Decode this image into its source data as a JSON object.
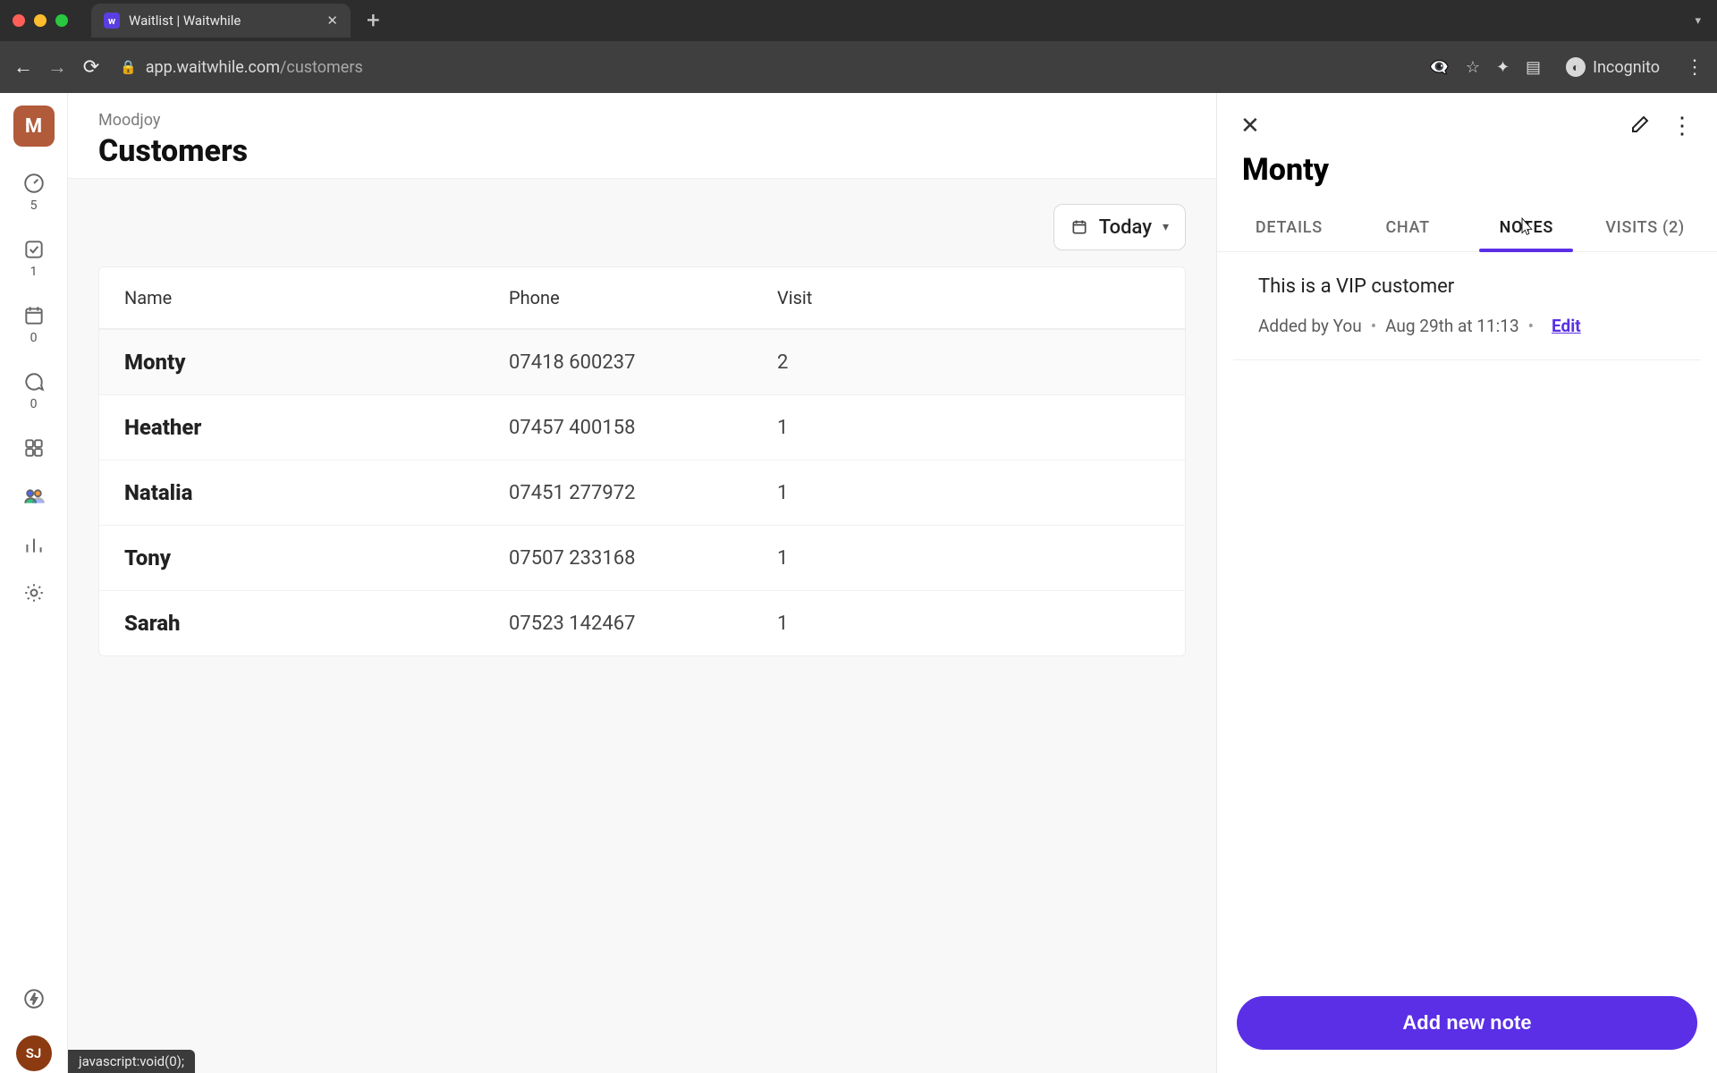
{
  "browser": {
    "tab_title": "Waitlist | Waitwhile",
    "favicon_letter": "w",
    "url_host": "app.waitwhile.com",
    "url_path": "/customers",
    "incognito_label": "Incognito",
    "status_text": "javascript:void(0);"
  },
  "sidebar": {
    "org_initial": "M",
    "user_initials": "SJ",
    "counts": {
      "dashboard": "5",
      "queue": "1",
      "calendar": "0",
      "chat": "0"
    }
  },
  "header": {
    "breadcrumb": "Moodjoy",
    "title": "Customers"
  },
  "toolbar": {
    "today_label": "Today"
  },
  "table": {
    "columns": {
      "name": "Name",
      "phone": "Phone",
      "visit": "Visit"
    },
    "rows": [
      {
        "name": "Monty",
        "phone": "07418 600237",
        "visit": "2",
        "selected": true
      },
      {
        "name": "Heather",
        "phone": "07457 400158",
        "visit": "1",
        "selected": false
      },
      {
        "name": "Natalia",
        "phone": "07451 277972",
        "visit": "1",
        "selected": false
      },
      {
        "name": "Tony",
        "phone": "07507 233168",
        "visit": "1",
        "selected": false
      },
      {
        "name": "Sarah",
        "phone": "07523 142467",
        "visit": "1",
        "selected": false
      }
    ]
  },
  "panel": {
    "customer_name": "Monty",
    "tabs": {
      "details": "DETAILS",
      "chat": "CHAT",
      "notes": "NOTES",
      "visits": "VISITS (2)"
    },
    "note": {
      "text": "This is a VIP customer",
      "added_by": "Added by You",
      "date": "Aug 29th at 11:13",
      "edit_label": "Edit"
    },
    "add_button": "Add new note"
  }
}
